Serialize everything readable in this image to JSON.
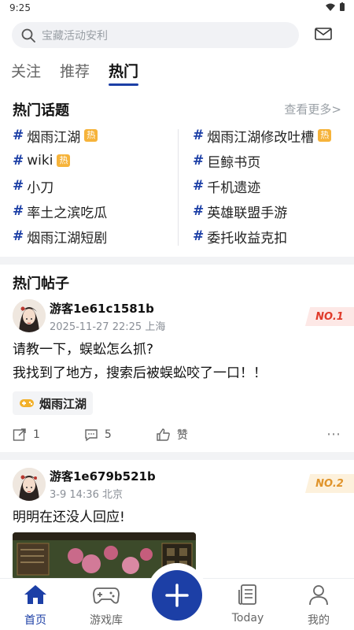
{
  "status": {
    "time": "9:25"
  },
  "search": {
    "placeholder": "宝藏活动安利"
  },
  "tabs": [
    {
      "label": "关注"
    },
    {
      "label": "推荐"
    },
    {
      "label": "热门"
    }
  ],
  "hot_topics": {
    "title": "热门话题",
    "more": "查看更多>",
    "hot_badge": "热",
    "left": [
      {
        "name": "烟雨江湖",
        "hot": true
      },
      {
        "name": "wiki",
        "hot": true
      },
      {
        "name": "小刀",
        "hot": false
      },
      {
        "name": "率土之滨吃瓜",
        "hot": false
      },
      {
        "name": "烟雨江湖短剧",
        "hot": false
      }
    ],
    "right": [
      {
        "name": "烟雨江湖修改吐槽",
        "hot": true
      },
      {
        "name": "巨鲸书页",
        "hot": false
      },
      {
        "name": "千机遗迹",
        "hot": false
      },
      {
        "name": "英雄联盟手游",
        "hot": false
      },
      {
        "name": "委托收益克扣",
        "hot": false
      }
    ]
  },
  "hot_posts": {
    "title": "热门帖子",
    "posts": [
      {
        "user": "游客1e61c1581b",
        "date": "2025-11-27",
        "time": "22:25",
        "location": "上海",
        "rank": "NO.1",
        "lines": [
          "请教一下，蜈蚣怎么抓?",
          "我找到了地方，搜索后被蜈蚣咬了一口！！"
        ],
        "game": "烟雨江湖",
        "shares": "1",
        "comments": "5",
        "like_label": "赞"
      },
      {
        "user": "游客1e679b521b",
        "date": "3-9",
        "time": "14:36",
        "location": "北京",
        "rank": "NO.2",
        "lines": [
          "明明在还没人回应!"
        ]
      }
    ]
  },
  "bottom_nav": [
    {
      "label": "首页",
      "active": true
    },
    {
      "label": "游戏库"
    },
    {
      "label": "Today"
    },
    {
      "label": "我的"
    }
  ],
  "colors": {
    "accent": "#1c3fa6",
    "hot": "#f6b33a",
    "rank1": "#e03b2b",
    "rank2": "#e0942b"
  }
}
